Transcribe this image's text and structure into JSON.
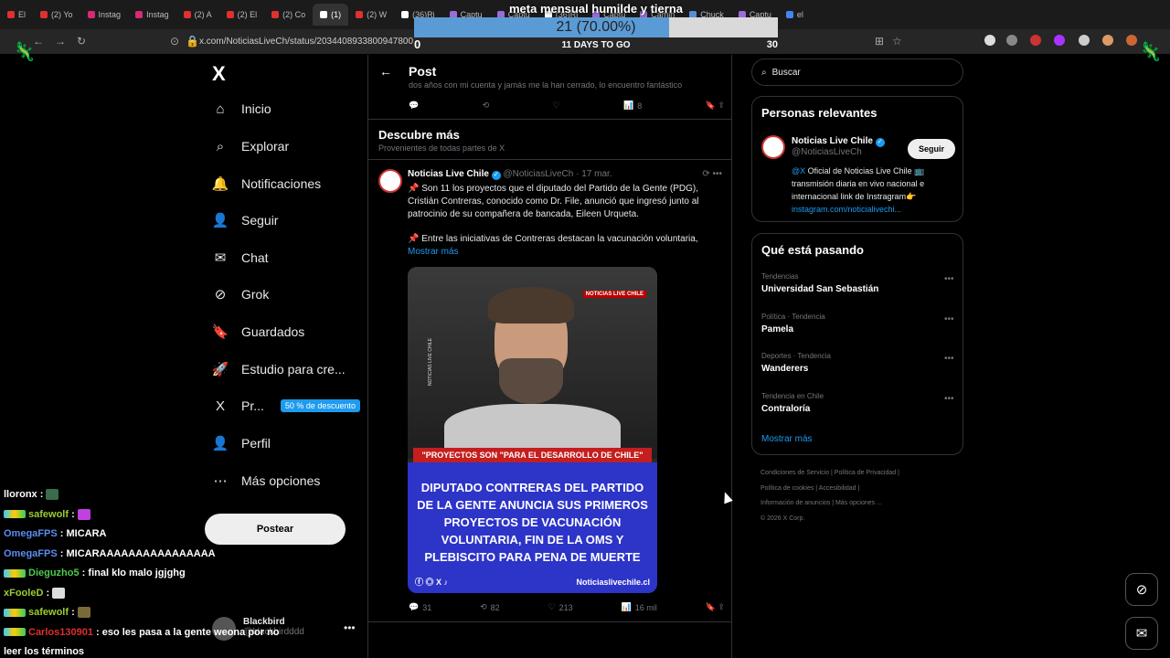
{
  "browser": {
    "tabs": [
      {
        "label": "El",
        "color": "#e03030"
      },
      {
        "label": "(2) Yo",
        "color": "#e03030"
      },
      {
        "label": "Instag",
        "color": "#d62976"
      },
      {
        "label": "Instag",
        "color": "#d62976"
      },
      {
        "label": "(2) A",
        "color": "#e03030"
      },
      {
        "label": "(2) El",
        "color": "#e03030"
      },
      {
        "label": "(2) Co",
        "color": "#e03030"
      },
      {
        "label": "(1)",
        "color": "#ffffff",
        "active": true
      },
      {
        "label": "(2) W",
        "color": "#e03030"
      },
      {
        "label": "(36)Ri",
        "color": "#ffffff"
      },
      {
        "label": "Captu",
        "color": "#9b6bd6"
      },
      {
        "label": "Captu",
        "color": "#9b6bd6"
      },
      {
        "label": "(36)Ri",
        "color": "#ffffff"
      },
      {
        "label": "Captu",
        "color": "#9b6bd6"
      },
      {
        "label": "Camin",
        "color": "#9b6bd6"
      },
      {
        "label": "Chuck",
        "color": "#5a8dd6"
      },
      {
        "label": "Captu",
        "color": "#9b6bd6"
      },
      {
        "label": "el",
        "color": "#4285f4"
      }
    ],
    "url": "x.com/NoticiasLiveCh/status/2034408933800947800"
  },
  "goal": {
    "title": "meta mensual humilde y tierna",
    "progress": 0.7,
    "value_text": "21 (70.00%)",
    "min": "0",
    "max": "30",
    "days": "11 DAYS TO GO"
  },
  "sidebar": {
    "logo": "X",
    "items": [
      {
        "label": "Inicio",
        "icon": "⌂"
      },
      {
        "label": "Explorar",
        "icon": "⌕"
      },
      {
        "label": "Notificaciones",
        "icon": "🔔"
      },
      {
        "label": "Seguir",
        "icon": "👤"
      },
      {
        "label": "Chat",
        "icon": "✉"
      },
      {
        "label": "Grok",
        "icon": "⊘"
      },
      {
        "label": "Guardados",
        "icon": "🔖"
      },
      {
        "label": "Estudio para cre...",
        "icon": "🚀"
      },
      {
        "label": "Pr...",
        "icon": "X",
        "badge": "50 % de descuento"
      },
      {
        "label": "Perfil",
        "icon": "👤"
      },
      {
        "label": "Más opciones",
        "icon": "⋯"
      }
    ],
    "post_button": "Postear",
    "account": {
      "name": "Blackbird",
      "handle": "@blackbirdddd"
    }
  },
  "center": {
    "header": "Post",
    "prev_snippet": "dos años con mi cuenta y jamás me la han cerrado, lo encuentro fantástico",
    "prev_actions": {
      "views": "8"
    },
    "discover_title": "Descubre más",
    "discover_sub": "Provenientes de todas partes de X",
    "tweet": {
      "name": "Noticias Live Chile",
      "handle": "@NoticiasLiveCh",
      "date": "· 17 mar.",
      "text1": "📌 Son 11 los proyectos que el diputado del Partido de la Gente (PDG), Cristián Contreras, conocido como Dr. File, anunció que ingresó junto al patrocinio de su compañera de bancada, Eileen Urqueta.",
      "text2": "📌 Entre las iniciativas de Contreras destacan la vacunación voluntaria,",
      "more": "Mostrar más",
      "image": {
        "brand": "NOTICIAS LIVE CHILE",
        "vertical": "NOTICIAS LIVE CHILE",
        "quote": "\"PROYECTOS SON \"PARA EL DESARROLLO DE CHILE\"",
        "headline": "DIPUTADO CONTRERAS DEL PARTIDO DE LA GENTE ANUNCIA SUS PRIMEROS PROYECTOS DE VACUNACIÓN VOLUNTARIA, FIN DE LA OMS Y PLEBISCITO PARA PENA DE MUERTE",
        "site": "Noticiaslivechile.cl"
      },
      "replies": "31",
      "reposts": "82",
      "likes": "213",
      "views": "16 mil"
    }
  },
  "right": {
    "search_placeholder": "Buscar",
    "relevant_title": "Personas relevantes",
    "person": {
      "name": "Noticias Live Chile",
      "handle": "@NoticiasLiveCh",
      "follow": "Seguir",
      "bio_mention": "@X",
      "bio": " Oficial de Noticias Live Chile 📺 transmisión diaria en vivo nacional e internacional link de Instragram👉",
      "bio_link": "instagram.com/noticialivechi..."
    },
    "trends_title": "Qué está pasando",
    "trends": [
      {
        "category": "Tendencias",
        "name": "Universidad San Sebastián"
      },
      {
        "category": "Política · Tendencia",
        "name": "Pamela"
      },
      {
        "category": "Deportes · Tendencia",
        "name": "Wanderers"
      },
      {
        "category": "Tendencia en Chile",
        "name": "Contraloría"
      }
    ],
    "show_more": "Mostrar más",
    "footer": [
      "Condiciones de Servicio  |  Política de Privacidad  |",
      "Política de cookies  |  Accesibilidad  |",
      "Información de anuncios  |  Más opciones ...",
      "© 2026 X Corp."
    ]
  },
  "chat": [
    {
      "user": "lloronx",
      "color": "#ffffff",
      "msg": "",
      "badges": false
    },
    {
      "user": "safewolf",
      "color": "#9acd32",
      "msg": "",
      "badges": true
    },
    {
      "user": "OmegaFPS",
      "color": "#5b8def",
      "msg": "MICARA",
      "badges": false
    },
    {
      "user": "OmegaFPS",
      "color": "#5b8def",
      "msg": "MICARAAAAAAAAAAAAAAAA",
      "badges": false
    },
    {
      "user": "Dieguzho5",
      "color": "#4ecb4e",
      "msg": "final klo malo jgjghg",
      "badges": true
    },
    {
      "user": "xFooleD",
      "color": "#9acd32",
      "msg": "",
      "badges": false
    },
    {
      "user": "safewolf",
      "color": "#9acd32",
      "msg": "",
      "badges": true
    },
    {
      "user": "Carlos130901",
      "color": "#e03030",
      "msg": "eso les pasa a la gente weona por no",
      "badges": true
    },
    {
      "user": "",
      "color": "#ffffff",
      "msg": "leer los términos",
      "badges": false
    }
  ]
}
